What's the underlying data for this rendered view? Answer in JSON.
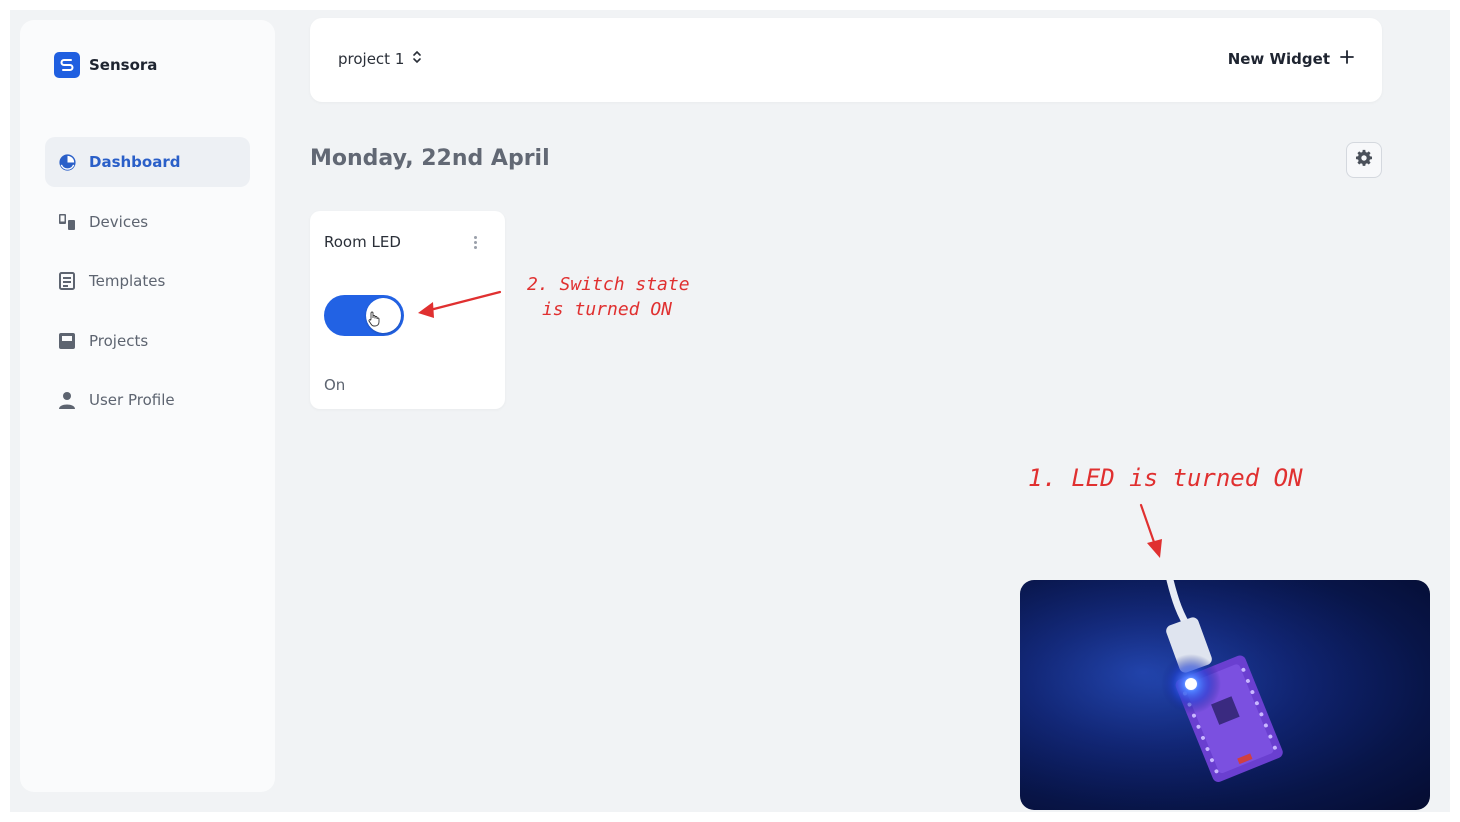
{
  "app": {
    "name": "Sensora"
  },
  "sidebar": {
    "items": [
      {
        "label": "Dashboard",
        "icon": "dashboard-icon",
        "active": true
      },
      {
        "label": "Devices",
        "icon": "devices-icon",
        "active": false
      },
      {
        "label": "Templates",
        "icon": "templates-icon",
        "active": false
      },
      {
        "label": "Projects",
        "icon": "projects-icon",
        "active": false
      },
      {
        "label": "User Profile",
        "icon": "user-icon",
        "active": false
      }
    ]
  },
  "topbar": {
    "project": "project 1",
    "new_widget": "New Widget"
  },
  "main": {
    "date": "Monday, 22nd April"
  },
  "widget": {
    "title": "Room LED",
    "state": "On",
    "toggle_on": true
  },
  "annotations": {
    "switch_line1": "2. Switch state",
    "switch_line2": "is turned ON",
    "led": "1. LED is turned ON"
  },
  "colors": {
    "accent": "#2262e4",
    "annotation": "#e03030"
  }
}
